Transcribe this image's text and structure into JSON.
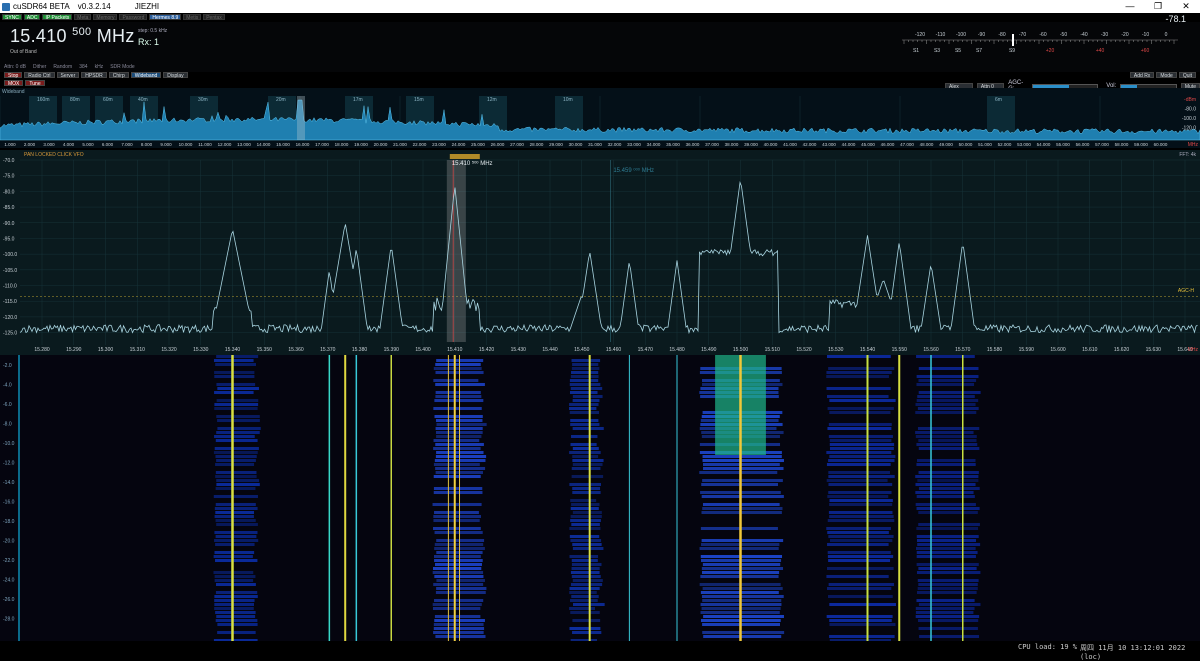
{
  "window": {
    "title": "cuSDR64 BETA",
    "version": "v0.3.2.14",
    "user": "JIEZHI",
    "controls": [
      "—",
      "❐",
      "✕"
    ]
  },
  "status": [
    "SYNC",
    "ADC",
    "IP Packets",
    "Meta",
    "Memory",
    "Password",
    "Hermes 8.9",
    "Metis",
    "Pentax"
  ],
  "vfo": {
    "freq_main": "15.410",
    "freq_small": "500",
    "unit": "MHz",
    "step": "step: 0.5 kHz",
    "rx": "Rx: 1",
    "band": "Out of Band",
    "options": [
      "Attn: 0 dB",
      "Dither",
      "Random",
      "384",
      "kHz",
      "SDR Mode"
    ]
  },
  "smeter": {
    "value": "-78.1",
    "scale_top": [
      "-120",
      "-110",
      "-100",
      "-90",
      "-80",
      "-70",
      "-60",
      "-50",
      "-40",
      "-30",
      "-20",
      "-10",
      "0"
    ],
    "scale_bot": [
      "S1",
      "S3",
      "S5",
      "S7",
      "S9",
      "+20",
      "+40",
      "+60"
    ]
  },
  "buttons": [
    "Stop",
    "Radio Ctrl",
    "Server",
    "HPSDR",
    "Chirp",
    "Wideband",
    "Display",
    "MOX",
    "Tune"
  ],
  "right_buttons": [
    "Add Rx",
    "Mode",
    "Quit"
  ],
  "agc": {
    "alex": "Alex Auto",
    "attn": "Attn 0 dB",
    "label": "AGC-G:",
    "vol_label": "Vol:",
    "mute": "Mute",
    "agc_level": 0.55,
    "vol_level": 0.28
  },
  "wideband": {
    "label": "Wideband",
    "bands": [
      "160m",
      "80m",
      "60m",
      "40m",
      "30m",
      "20m",
      "17m",
      "15m",
      "12m",
      "10m",
      "6m"
    ],
    "xlabels": [
      "1.000",
      "2.000",
      "3.000",
      "4.000",
      "5.000",
      "6.000",
      "7.000",
      "8.000",
      "9.000",
      "10.000",
      "11.000",
      "12.000",
      "13.000",
      "14.000",
      "15.000",
      "16.000",
      "17.000",
      "18.000",
      "19.000",
      "20.000",
      "21.000",
      "22.000",
      "23.000",
      "24.000",
      "25.000",
      "26.000",
      "27.000",
      "28.000",
      "29.000",
      "30.000",
      "31.000",
      "32.000",
      "33.000",
      "34.000",
      "35.000",
      "36.000",
      "37.000",
      "38.000",
      "39.000",
      "40.000",
      "41.000",
      "42.000",
      "43.000",
      "44.000",
      "45.000",
      "46.000",
      "47.000",
      "48.000",
      "49.000",
      "50.000",
      "51.000",
      "52.000",
      "53.000",
      "54.000",
      "55.000",
      "56.000",
      "57.000",
      "58.000",
      "59.000",
      "60.000"
    ],
    "unit": "MHz",
    "ylabels": [
      "-dBm",
      "-80.0",
      "-100.0",
      "-120.0"
    ]
  },
  "panadapter": {
    "mode": "PAN LOCKED   CLICK VFO",
    "fft": "FFT: 4k",
    "agch": "AGC-H",
    "marker_main": "15.410",
    "marker_small": "500",
    "marker_unit": "MHz",
    "second_vfo": "15.459",
    "second_vfo_small": "000",
    "second_vfo_unit": "MHz",
    "ylabels": [
      "-70.0",
      "-75.0",
      "-80.0",
      "-85.0",
      "-90.0",
      "-95.0",
      "-100.0",
      "-105.0",
      "-110.0",
      "-115.0",
      "-120.0",
      "-125.0"
    ],
    "xlabels": [
      "15.280",
      "15.290",
      "15.300",
      "15.310",
      "15.320",
      "15.330",
      "15.340",
      "15.350",
      "15.360",
      "15.370",
      "15.380",
      "15.390",
      "15.400",
      "15.410",
      "15.420",
      "15.430",
      "15.440",
      "15.450",
      "15.460",
      "15.470",
      "15.480",
      "15.490",
      "15.500",
      "15.510",
      "15.520",
      "15.530",
      "15.540",
      "15.550",
      "15.560",
      "15.570",
      "15.580",
      "15.590",
      "15.600",
      "15.610",
      "15.620",
      "15.630",
      "15.640"
    ],
    "unit": "MHz",
    "peaks_mhz": [
      15.34,
      15.3705,
      15.3755,
      15.379,
      15.39,
      15.408,
      15.41,
      15.4115,
      15.45,
      15.4525,
      15.465,
      15.48,
      15.496,
      15.5,
      15.505,
      15.54,
      15.545,
      15.55,
      15.56,
      15.57,
      15.64
    ]
  },
  "waterfall": {
    "ylabels": [
      "-2.0",
      "-4.0",
      "-6.0",
      "-8.0",
      "-10.0",
      "-12.0",
      "-14.0",
      "-16.0",
      "-18.0",
      "-20.0",
      "-22.0",
      "-24.0",
      "-26.0",
      "-28.0"
    ]
  },
  "footer": {
    "cpu": "CPU load: 19 %",
    "clock": "周四 11月 10 13:12:01 2022 (loc)"
  }
}
